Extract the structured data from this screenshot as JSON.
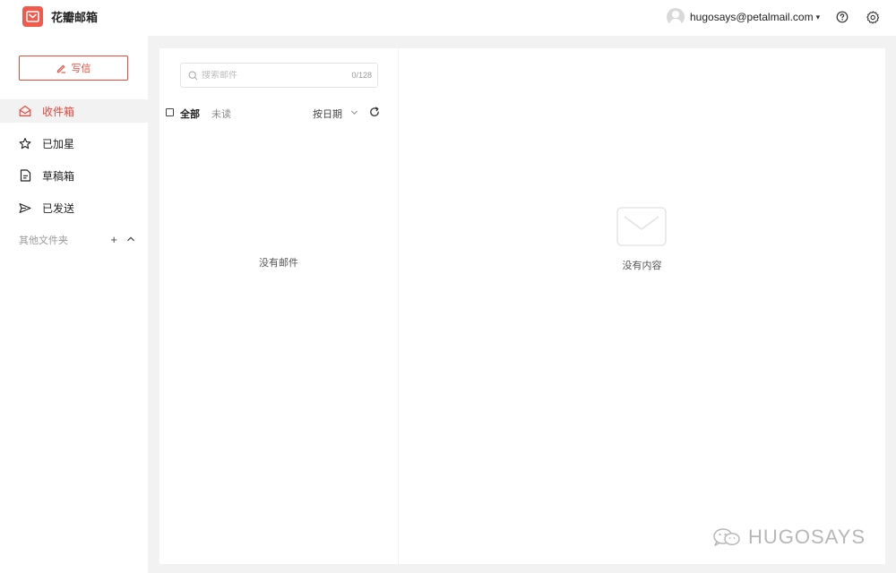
{
  "app": {
    "name": "花瓣邮箱"
  },
  "header": {
    "account_email": "hugosays@petalmail.com",
    "caret": "▾",
    "help_icon": "help-circle-icon",
    "settings_icon": "gear-icon"
  },
  "sidebar": {
    "compose_label": "写信",
    "items": [
      {
        "label": "收件箱",
        "icon": "inbox-icon",
        "active": true
      },
      {
        "label": "已加星",
        "icon": "star-icon",
        "active": false
      },
      {
        "label": "草稿箱",
        "icon": "draft-icon",
        "active": false
      },
      {
        "label": "已发送",
        "icon": "send-icon",
        "active": false
      }
    ],
    "other_folders_label": "其他文件夹",
    "add_symbol": "+",
    "collapse_symbol": "⌃"
  },
  "mail_list": {
    "search_placeholder": "搜索邮件",
    "search_value": "",
    "search_count": "0/128",
    "filter_all": "全部",
    "filter_unread": "未读",
    "sort_label": "按日期",
    "sort_chevron": "⌄",
    "empty_text": "没有邮件"
  },
  "reading_pane": {
    "empty_text": "没有内容",
    "empty_icon": "envelope-icon"
  },
  "watermark": {
    "text": "HUGOSAYS",
    "icon": "wechat-icon"
  },
  "colors": {
    "accent": "#e8473a",
    "logo_bg": "#f0594b",
    "content_bg": "#f2f2f2",
    "active_item_bg": "#f2f2f2"
  }
}
